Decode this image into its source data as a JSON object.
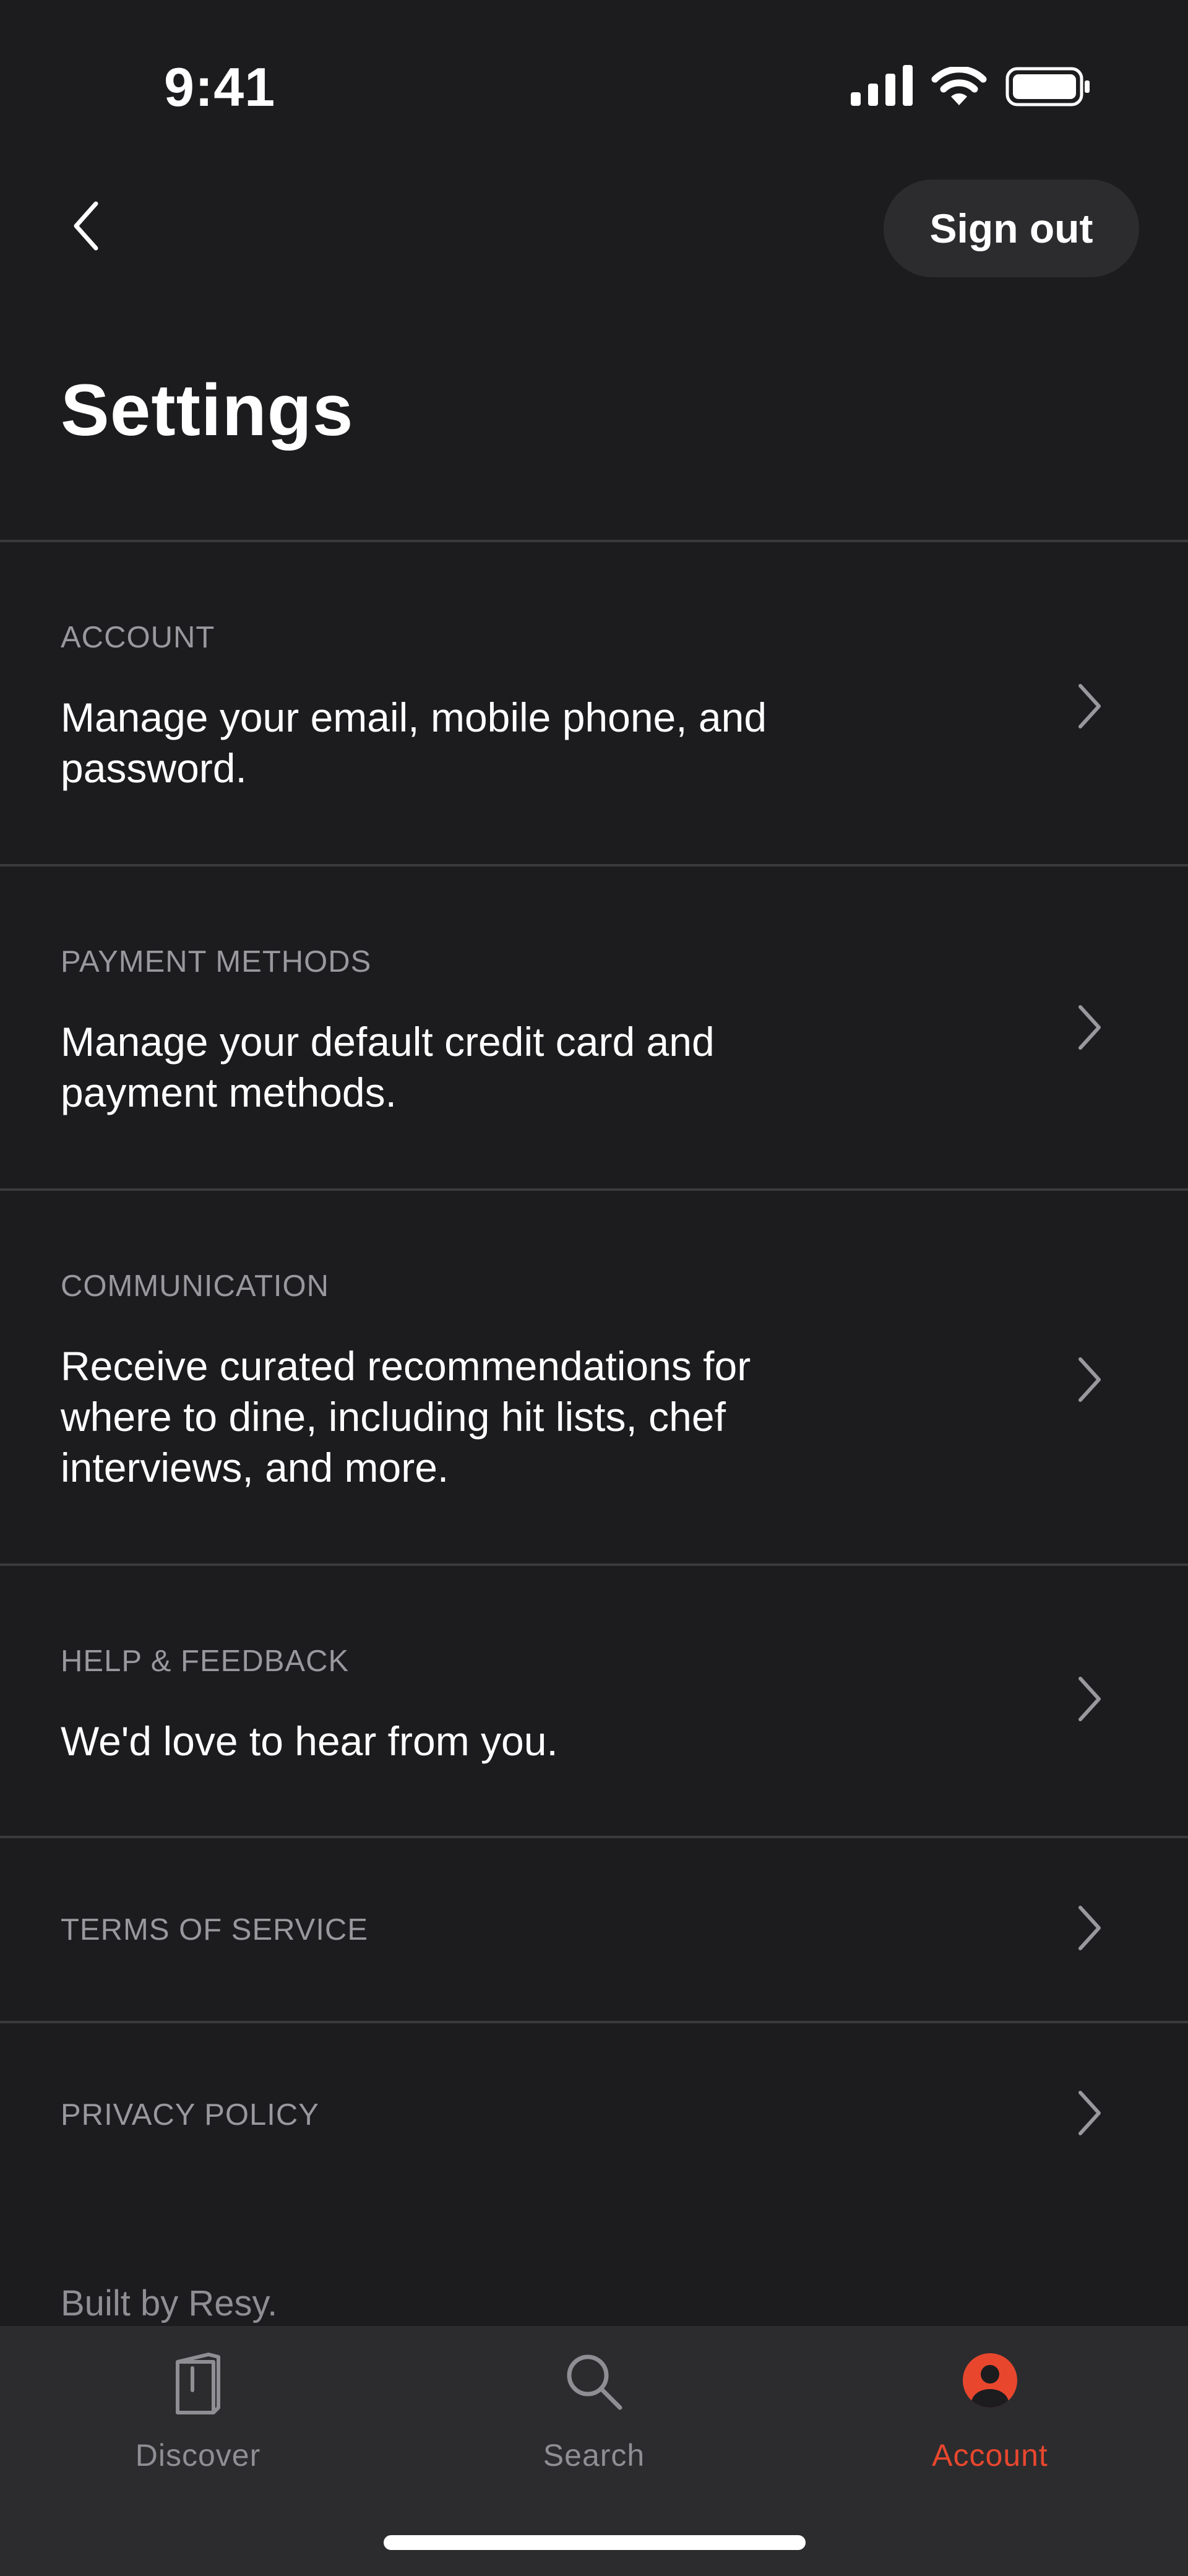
{
  "status_bar": {
    "time": "9:41"
  },
  "header": {
    "back_icon": "chevron-left-icon",
    "sign_out_label": "Sign out",
    "title": "Settings"
  },
  "settings": [
    {
      "label": "ACCOUNT",
      "description": "Manage your email, mobile phone, and password."
    },
    {
      "label": "PAYMENT METHODS",
      "description": "Manage your default credit card and payment methods."
    },
    {
      "label": "COMMUNICATION",
      "description": "Receive curated recommendations for where to dine, including hit lists, chef interviews, and more."
    },
    {
      "label": "HELP & FEEDBACK",
      "description": "We'd love to hear from you."
    },
    {
      "label": "TERMS OF SERVICE",
      "description": ""
    },
    {
      "label": "PRIVACY POLICY",
      "description": ""
    }
  ],
  "footer": {
    "text": "Built by Resy."
  },
  "tab_bar": {
    "tabs": [
      {
        "label": "Discover",
        "icon": "book-icon",
        "active": false
      },
      {
        "label": "Search",
        "icon": "search-icon",
        "active": false
      },
      {
        "label": "Account",
        "icon": "user-circle-icon",
        "active": true
      }
    ]
  },
  "colors": {
    "background": "#1c1c1e",
    "tab_bar": "#2c2c2e",
    "accent": "#e8472e",
    "inactive": "#8e8e93"
  }
}
